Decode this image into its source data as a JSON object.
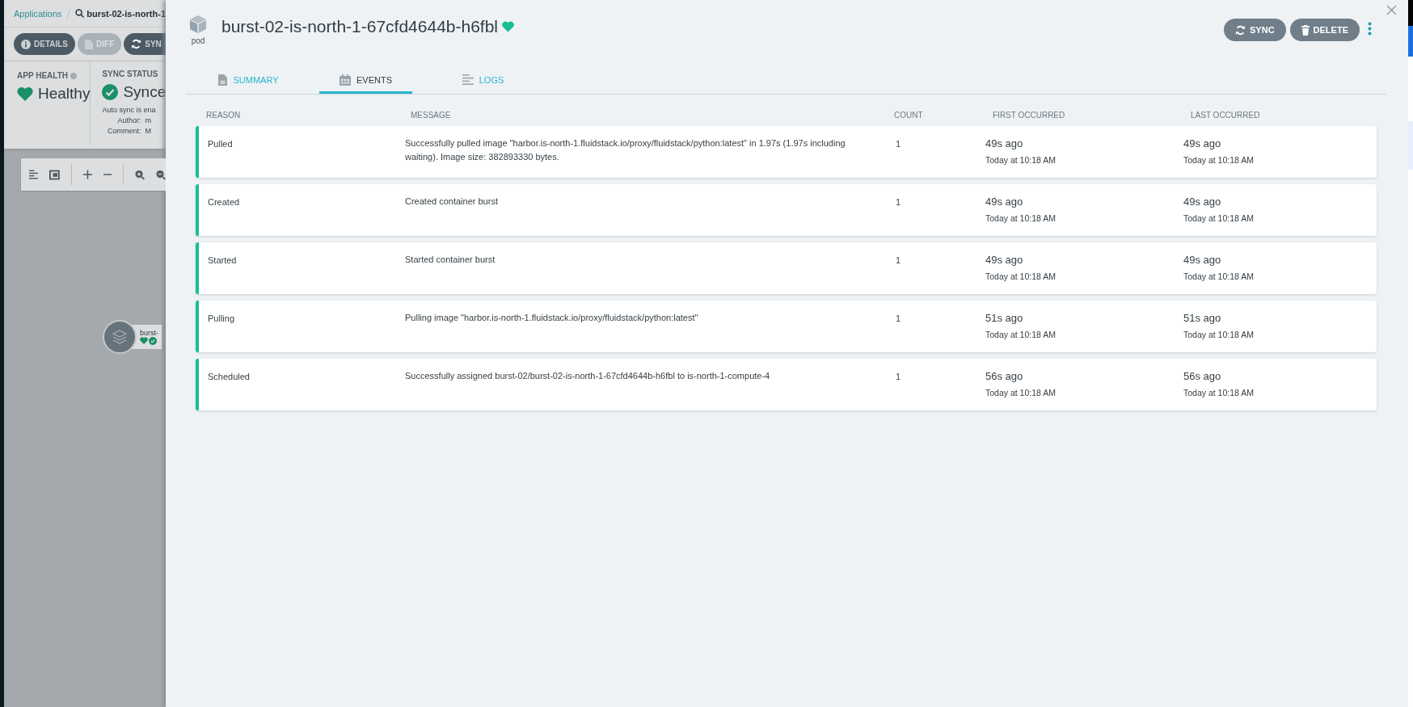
{
  "background_app": {
    "breadcrumb": {
      "link": "Applications",
      "current": "burst-02-is-north-1"
    },
    "buttons": [
      {
        "label": "DETAILS",
        "kind": "details",
        "disabled": false
      },
      {
        "label": "DIFF",
        "kind": "diff",
        "disabled": true
      },
      {
        "label": "SYN",
        "kind": "sync",
        "disabled": false
      }
    ],
    "app_health": {
      "label": "APP HEALTH",
      "value": "Healthy"
    },
    "sync_status": {
      "label": "SYNC STATUS",
      "value": "Synce",
      "note": "Auto sync is ena",
      "fields": [
        {
          "label": "Author:",
          "value": "m"
        },
        {
          "label": "Comment:",
          "value": "M"
        }
      ]
    },
    "graph_node": {
      "name": "burst-"
    }
  },
  "panel": {
    "kind_label": "pod",
    "title": "burst-02-is-north-1-67cfd4644b-h6fbl",
    "actions": [
      {
        "label": "SYNC",
        "kind": "sync"
      },
      {
        "label": "DELETE",
        "kind": "delete"
      }
    ],
    "tabs": [
      {
        "label": "SUMMARY",
        "kind": "summary",
        "selected": false
      },
      {
        "label": "EVENTS",
        "kind": "events",
        "selected": true
      },
      {
        "label": "LOGS",
        "kind": "logs",
        "selected": false
      }
    ],
    "table": {
      "columns": [
        "REASON",
        "MESSAGE",
        "COUNT",
        "FIRST OCCURRED",
        "LAST OCCURRED"
      ],
      "rows": [
        {
          "reason": "Pulled",
          "message": "Successfully pulled image \"harbor.is-north-1.fluidstack.io/proxy/fluidstack/python:latest\" in 1.97s (1.97s including waiting). Image size: 382893330 bytes.",
          "count": "1",
          "first": {
            "ago": "49s ago",
            "time": "Today at 10:18 AM"
          },
          "last": {
            "ago": "49s ago",
            "time": "Today at 10:18 AM"
          }
        },
        {
          "reason": "Created",
          "message": "Created container burst",
          "count": "1",
          "first": {
            "ago": "49s ago",
            "time": "Today at 10:18 AM"
          },
          "last": {
            "ago": "49s ago",
            "time": "Today at 10:18 AM"
          }
        },
        {
          "reason": "Started",
          "message": "Started container burst",
          "count": "1",
          "first": {
            "ago": "49s ago",
            "time": "Today at 10:18 AM"
          },
          "last": {
            "ago": "49s ago",
            "time": "Today at 10:18 AM"
          }
        },
        {
          "reason": "Pulling",
          "message": "Pulling image \"harbor.is-north-1.fluidstack.io/proxy/fluidstack/python:latest\"",
          "count": "1",
          "first": {
            "ago": "51s ago",
            "time": "Today at 10:18 AM"
          },
          "last": {
            "ago": "51s ago",
            "time": "Today at 10:18 AM"
          }
        },
        {
          "reason": "Scheduled",
          "message": "Successfully assigned burst-02/burst-02-is-north-1-67cfd4644b-h6fbl to is-north-1-compute-4",
          "count": "1",
          "first": {
            "ago": "56s ago",
            "time": "Today at 10:18 AM"
          },
          "last": {
            "ago": "56s ago",
            "time": "Today at 10:18 AM"
          }
        }
      ]
    }
  }
}
